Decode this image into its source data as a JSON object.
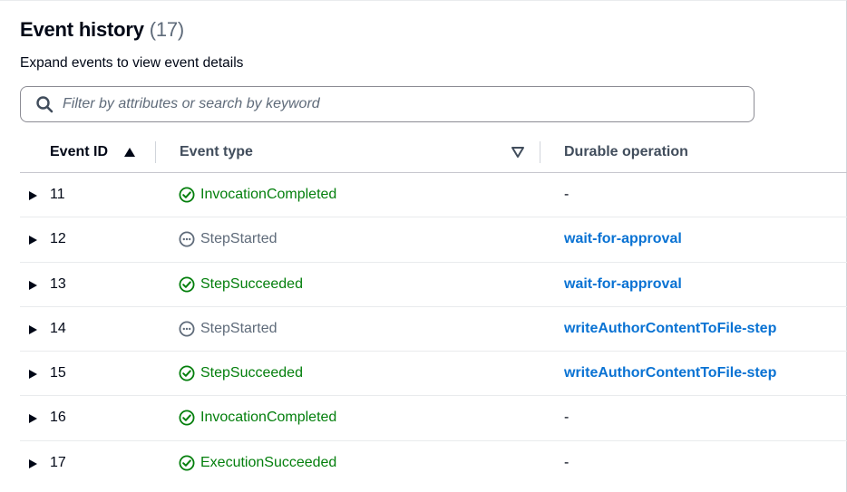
{
  "header": {
    "title": "Event history",
    "count": "(17)",
    "subtitle": "Expand events to view event details"
  },
  "search": {
    "placeholder": "Filter by attributes or search by keyword",
    "icon": "search-icon"
  },
  "table": {
    "columns": {
      "event_id": "Event ID",
      "event_type": "Event type",
      "durable_operation": "Durable operation"
    },
    "sort": {
      "column": "event_id",
      "direction": "ascending"
    },
    "rows": [
      {
        "id": "11",
        "type": "InvocationCompleted",
        "status": "success",
        "operation": "-",
        "operation_is_link": false
      },
      {
        "id": "12",
        "type": "StepStarted",
        "status": "pending",
        "operation": "wait-for-approval",
        "operation_is_link": true
      },
      {
        "id": "13",
        "type": "StepSucceeded",
        "status": "success",
        "operation": "wait-for-approval",
        "operation_is_link": true
      },
      {
        "id": "14",
        "type": "StepStarted",
        "status": "pending",
        "operation": "writeAuthorContentToFile-step",
        "operation_is_link": true
      },
      {
        "id": "15",
        "type": "StepSucceeded",
        "status": "success",
        "operation": "writeAuthorContentToFile-step",
        "operation_is_link": true
      },
      {
        "id": "16",
        "type": "InvocationCompleted",
        "status": "success",
        "operation": "-",
        "operation_is_link": false
      },
      {
        "id": "17",
        "type": "ExecutionSucceeded",
        "status": "success",
        "operation": "-",
        "operation_is_link": false
      }
    ]
  },
  "colors": {
    "success": "#037f0c",
    "pending": "#5f6b7a",
    "link": "#0972d3",
    "text": "#000716"
  }
}
